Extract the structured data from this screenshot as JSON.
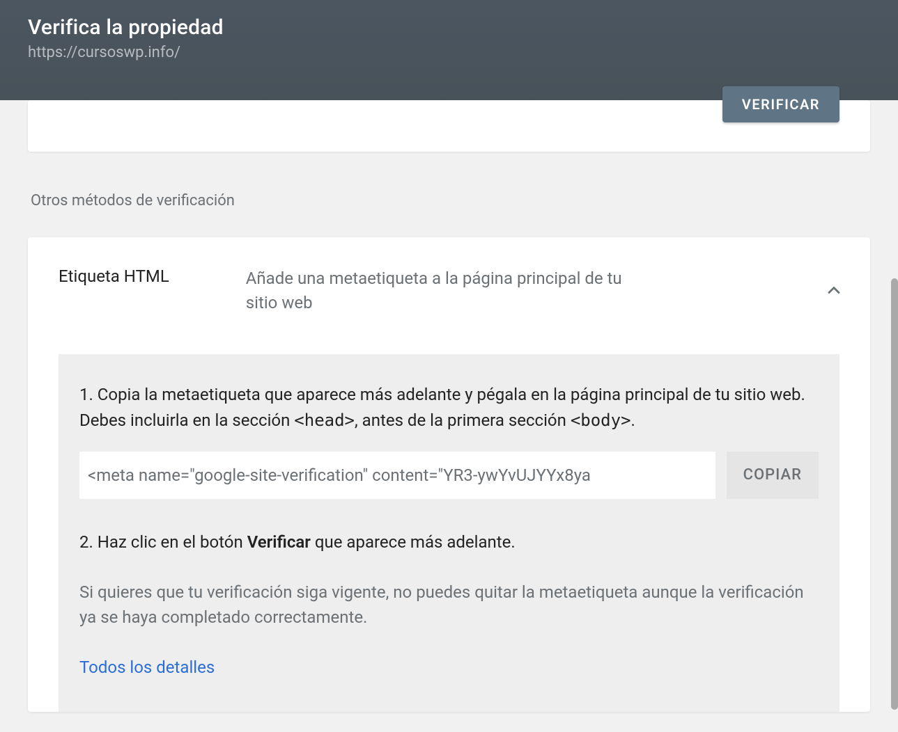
{
  "header": {
    "title": "Verifica la propiedad",
    "url": "https://cursoswp.info/"
  },
  "top_card": {
    "verify_button": "VERIFICAR"
  },
  "section_label": "Otros métodos de verificación",
  "method": {
    "title": "Etiqueta HTML",
    "description": "Añade una metaetiqueta a la página principal de tu sitio web",
    "step1_a": "1. Copia la metaetiqueta que aparece más adelante y pégala en la página principal de tu sitio web. Debes incluirla en la sección ",
    "step1_head": "<head>",
    "step1_b": ", antes de la primera sección ",
    "step1_body": "<body>",
    "step1_c": ".",
    "meta_tag": "<meta name=\"google-site-verification\" content=\"YR3-ywYvUJYYx8ya",
    "copy_button": "COPIAR",
    "step2_a": "2. Haz clic en el botón ",
    "step2_bold": "Verificar",
    "step2_b": " que aparece más adelante.",
    "note": "Si quieres que tu verificación siga vigente, no puedes quitar la metaetiqueta aunque la verificación ya se haya completado correctamente.",
    "details_link": "Todos los detalles"
  }
}
